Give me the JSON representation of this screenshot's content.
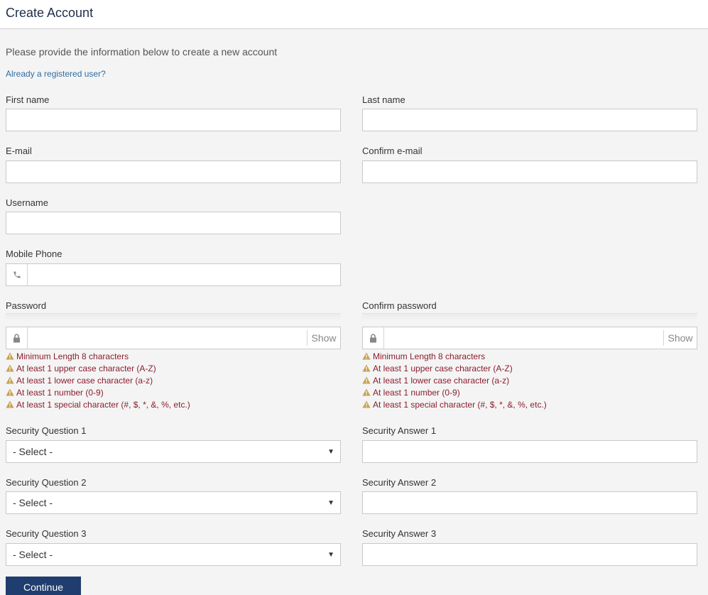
{
  "header": {
    "title": "Create Account"
  },
  "intro": "Please provide the information below to create a new account",
  "login_link": "Already a registered user?",
  "labels": {
    "first_name": "First name",
    "last_name": "Last name",
    "email": "E-mail",
    "confirm_email": "Confirm e-mail",
    "username": "Username",
    "mobile_phone": "Mobile Phone",
    "password": "Password",
    "confirm_password": "Confirm password",
    "sq1": "Security Question 1",
    "sa1": "Security Answer 1",
    "sq2": "Security Question 2",
    "sa2": "Security Answer 2",
    "sq3": "Security Question 3",
    "sa3": "Security Answer 3"
  },
  "values": {
    "first_name": "",
    "last_name": "",
    "email": "",
    "confirm_email": "",
    "username": "",
    "mobile_phone": "",
    "password": "",
    "confirm_password": "",
    "sa1": "",
    "sa2": "",
    "sa3": ""
  },
  "show_label": "Show",
  "password_requirements": [
    "Minimum Length 8 characters",
    "At least 1 upper case character (A-Z)",
    "At least 1 lower case character (a-z)",
    "At least 1 number (0-9)",
    "At least 1 special character (#, $, *, &, %, etc.)"
  ],
  "select_default": "- Select -",
  "continue_label": "Continue",
  "icons": {
    "phone": "phone-icon",
    "lock": "lock-icon",
    "warning": "warning-icon",
    "caret": "caret-down-icon"
  },
  "colors": {
    "header_text": "#1f2e4a",
    "link": "#2d6ea3",
    "warning_text": "#8b1e2e",
    "warning_icon": "#c8a04f",
    "button": "#1f3d6e",
    "background": "#f4f4f4"
  }
}
